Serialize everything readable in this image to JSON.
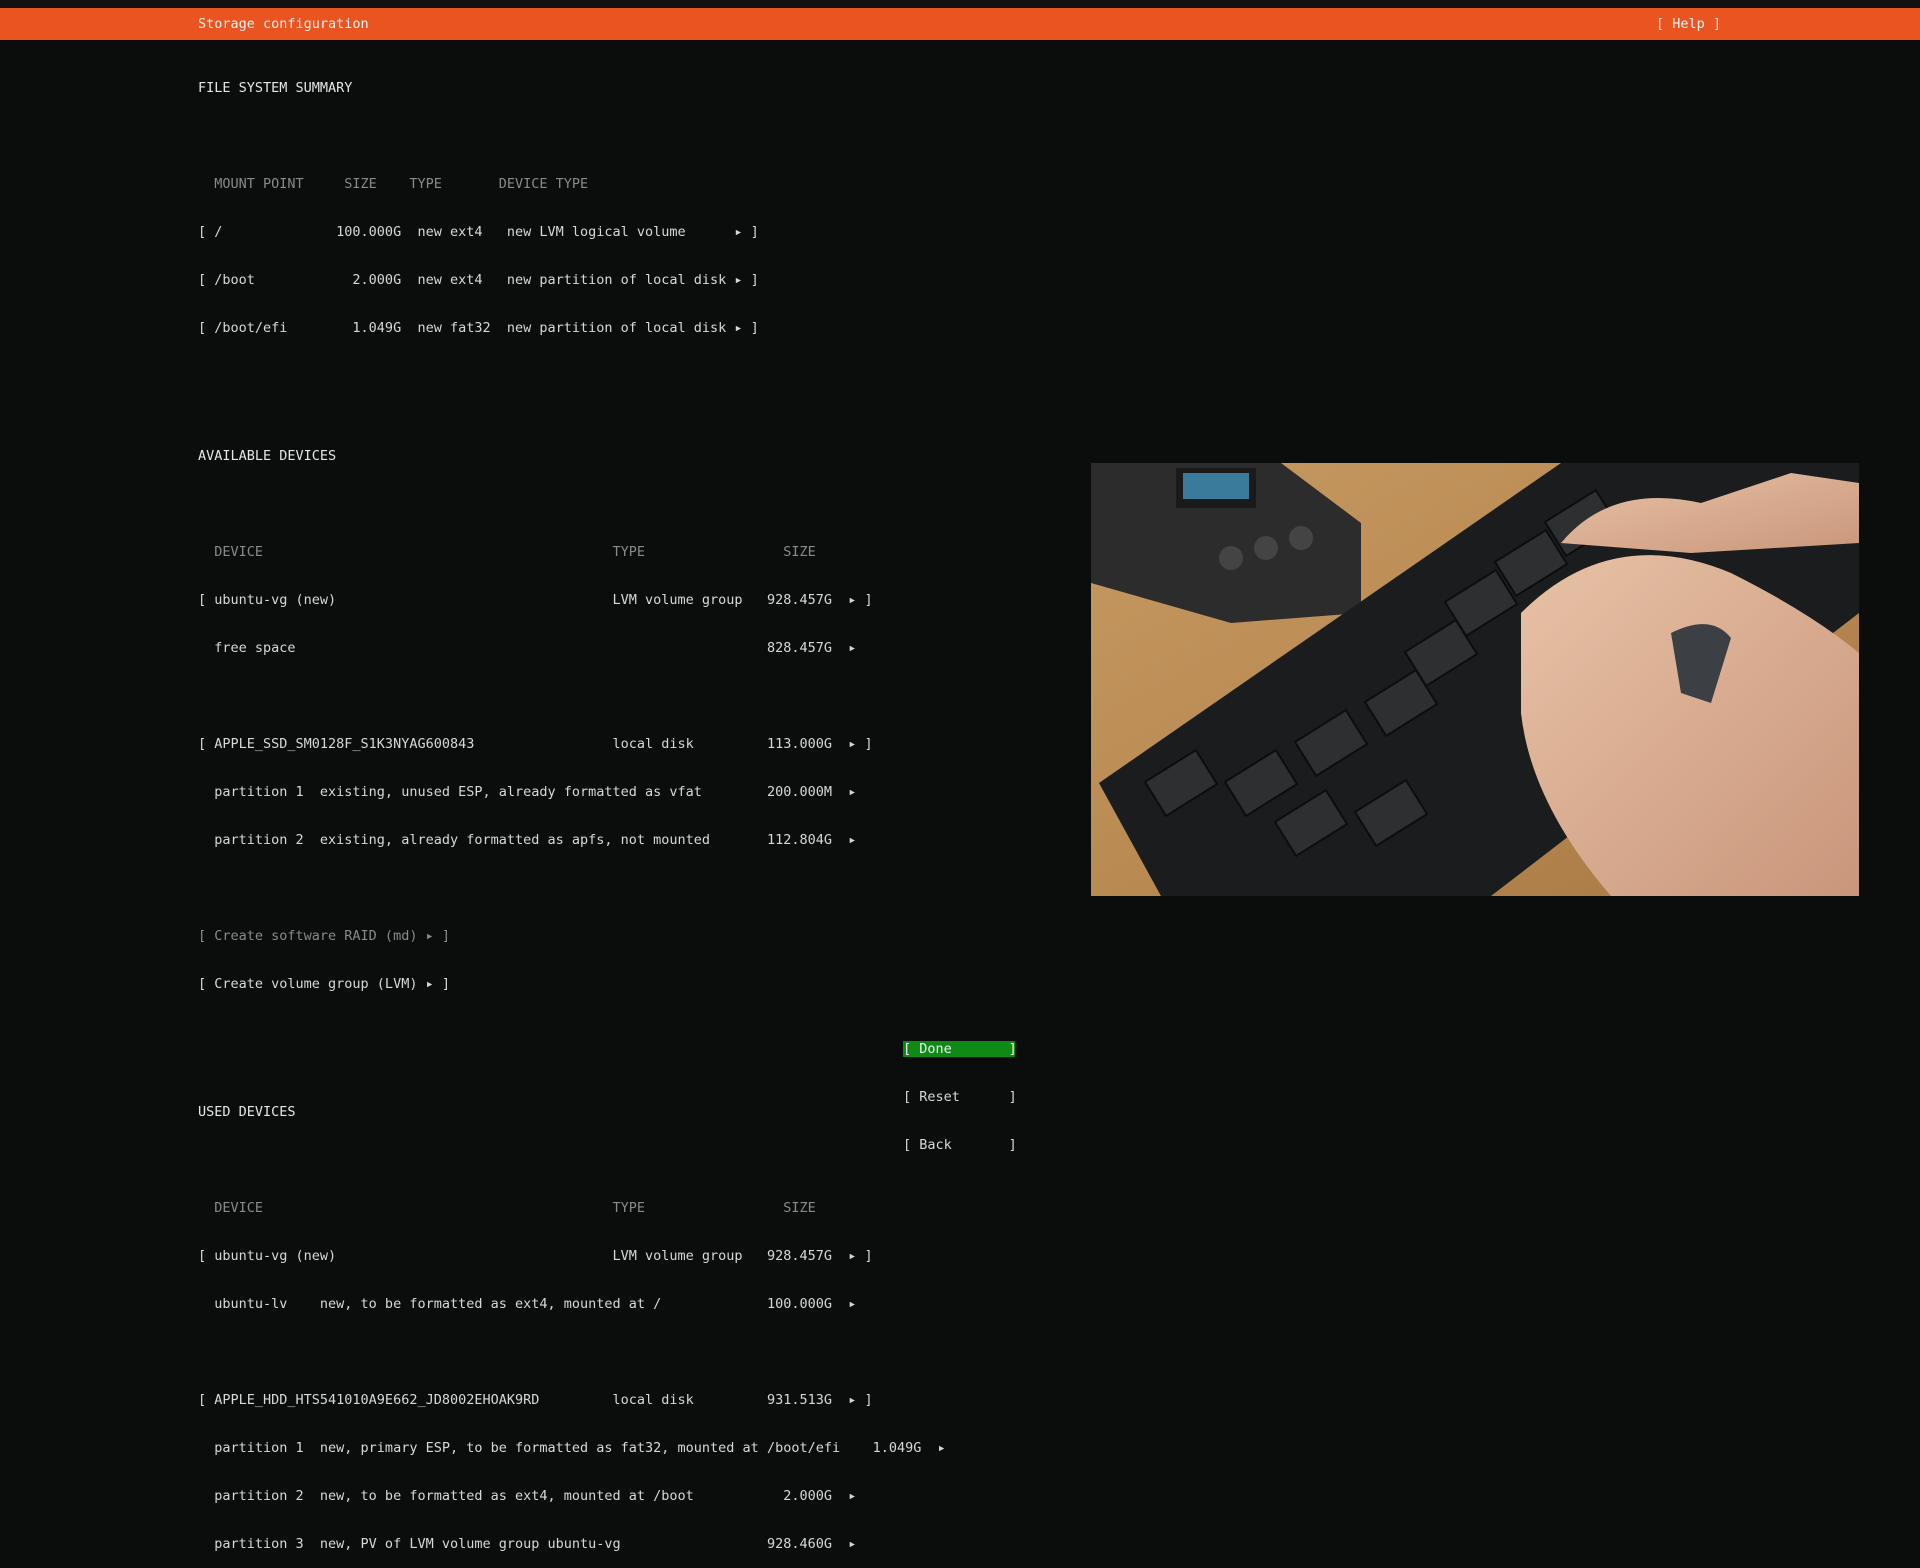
{
  "header": {
    "title": "Storage configuration",
    "help": "[ Help ]"
  },
  "fs_summary": {
    "title": "FILE SYSTEM SUMMARY",
    "columns": "  MOUNT POINT     SIZE    TYPE       DEVICE TYPE",
    "rows": [
      "[ /              100.000G  new ext4   new LVM logical volume      ▸ ]",
      "[ /boot            2.000G  new ext4   new partition of local disk ▸ ]",
      "[ /boot/efi        1.049G  new fat32  new partition of local disk ▸ ]"
    ]
  },
  "available": {
    "title": "AVAILABLE DEVICES",
    "columns": "  DEVICE                                           TYPE                 SIZE",
    "vg": [
      "[ ubuntu-vg (new)                                  LVM volume group   928.457G  ▸ ]",
      "  free space                                                          828.457G  ▸"
    ],
    "disk": [
      "[ APPLE_SSD_SM0128F_S1K3NYAG600843                 local disk         113.000G  ▸ ]",
      "  partition 1  existing, unused ESP, already formatted as vfat        200.000M  ▸",
      "  partition 2  existing, already formatted as apfs, not mounted       112.804G  ▸"
    ],
    "create_raid": "[ Create software RAID (md) ▸ ]",
    "create_vg": "[ Create volume group (LVM) ▸ ]"
  },
  "used": {
    "title": "USED DEVICES",
    "columns": "  DEVICE                                           TYPE                 SIZE",
    "vg": [
      "[ ubuntu-vg (new)                                  LVM volume group   928.457G  ▸ ]",
      "  ubuntu-lv    new, to be formatted as ext4, mounted at /             100.000G  ▸"
    ],
    "disk": [
      "[ APPLE_HDD_HTS541010A9E662_JD8002EHOAK9RD         local disk         931.513G  ▸ ]",
      "  partition 1  new, primary ESP, to be formatted as fat32, mounted at /boot/efi    1.049G  ▸",
      "  partition 2  new, to be formatted as ext4, mounted at /boot           2.000G  ▸",
      "  partition 3  new, PV of LVM volume group ubuntu-vg                  928.460G  ▸"
    ]
  },
  "buttons": {
    "done": "[ Done       ]",
    "reset": "[ Reset      ]",
    "back": "[ Back       ]"
  }
}
